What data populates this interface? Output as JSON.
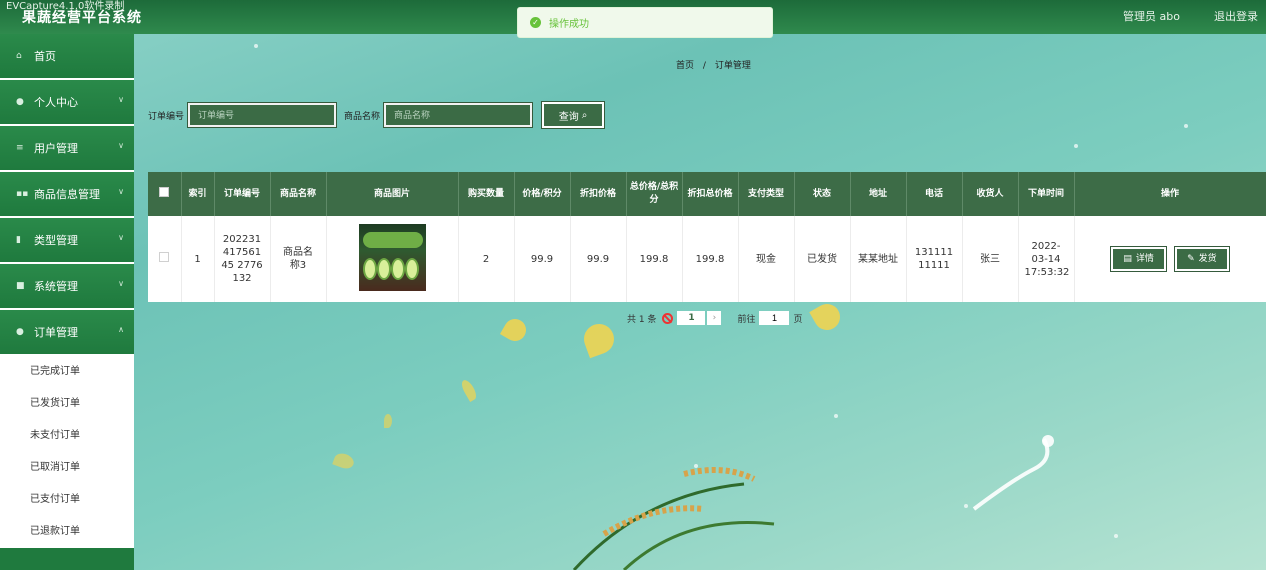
{
  "app": {
    "watermark": "EVCapture4.1.0软件录制",
    "title": "果蔬经营平台系统",
    "user": "管理员 abo",
    "logout": "退出登录"
  },
  "toast": {
    "message": "操作成功"
  },
  "sidebar": {
    "items": [
      {
        "label": "首页",
        "icon": "home-icon",
        "chevron": false
      },
      {
        "label": "个人中心",
        "icon": "user-icon",
        "chevron": true
      },
      {
        "label": "用户管理",
        "icon": "menu-icon",
        "chevron": true
      },
      {
        "label": "商品信息管理",
        "icon": "grid-icon",
        "chevron": true
      },
      {
        "label": "类型管理",
        "icon": "bar-chart-icon",
        "chevron": true
      },
      {
        "label": "系统管理",
        "icon": "card-icon",
        "chevron": true
      },
      {
        "label": "订单管理",
        "icon": "pin-icon",
        "chevron": true
      }
    ],
    "subitems": [
      "已完成订单",
      "已发货订单",
      "未支付订单",
      "已取消订单",
      "已支付订单",
      "已退款订单"
    ]
  },
  "breadcrumb": {
    "home": "首页",
    "separator": "/",
    "current": "订单管理"
  },
  "search": {
    "order_label": "订单编号",
    "order_placeholder": "订单编号",
    "product_label": "商品名称",
    "product_placeholder": "商品名称",
    "query_label": "查询",
    "query_icon": "search-icon"
  },
  "table": {
    "headers": [
      "索引",
      "订单编号",
      "商品名称",
      "商品图片",
      "购买数量",
      "价格/积分",
      "折扣价格",
      "总价格/总积分",
      "折扣总价格",
      "支付类型",
      "状态",
      "地址",
      "电话",
      "收货人",
      "下单时间",
      "操作"
    ],
    "rows": [
      {
        "index": "1",
        "order_no": "20223141756145 2776132",
        "product_name": "商品名称3",
        "quantity": "2",
        "price": "99.9",
        "discount_price": "99.9",
        "total_price": "199.8",
        "discount_total": "199.8",
        "pay_type": "现金",
        "status": "已发货",
        "address": "某某地址",
        "phone": "13111111111",
        "receiver": "张三",
        "order_time": "2022-03-14 17:53:32",
        "detail_label": "详情",
        "ship_label": "发货"
      }
    ]
  },
  "pagination": {
    "total_text": "共 1 条",
    "current_page": "1",
    "goto_label": "前往",
    "goto_value": "1",
    "page_suffix": "页"
  },
  "colors": {
    "primary": "#3b6b45",
    "sidebar": "#2a8a4a",
    "topbar": "#1d6b3a",
    "toast": "#67c23a"
  }
}
